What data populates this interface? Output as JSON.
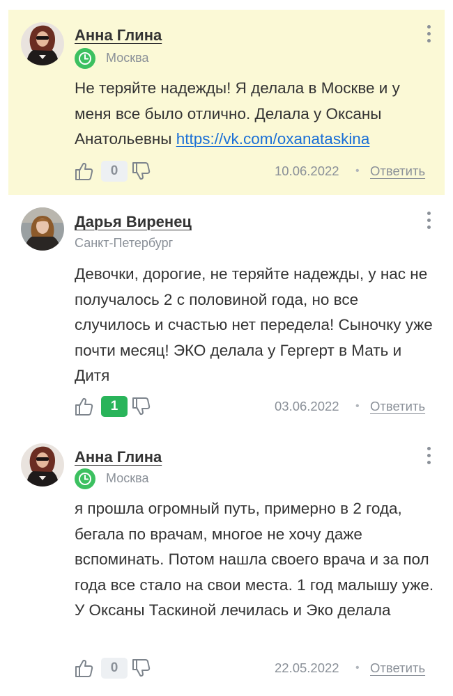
{
  "comments": [
    {
      "author": "Анна Глина",
      "has_verified_badge": true,
      "city": "Москва",
      "text_before_link": "Не теряйте надежды! Я делала в Москве и у меня все было отлично. Делала у Оксаны Анатольевны ",
      "link": "https://vk.com/oxanataskina",
      "votes": "0",
      "date": "10.06.2022",
      "separator": "•",
      "reply_label": "Ответить",
      "highlighted": true,
      "background_color": "#fbf9d6"
    },
    {
      "author": "Дарья Виренец",
      "has_verified_badge": false,
      "city": "Санкт-Петербург",
      "text": "Девочки, дорогие, не теряйте надежды, у нас не получалось 2 с половиной года, но все случилось и счастью нет передела! Сыночку уже почти месяц! ЭКО делала у Гергерт в Мать и Дитя",
      "votes": "1",
      "date": "03.06.2022",
      "separator": "•",
      "reply_label": "Ответить",
      "highlighted": false
    },
    {
      "author": "Анна Глина",
      "has_verified_badge": true,
      "city": "Москва",
      "text": "я прошла огромный путь, примерно в 2 года, бегала по врачам, многое не хочу даже вспоминать. Потом нашла своего врача и за пол года все стало на свои места. 1 год малышу уже. У Оксаны Таскиной лечилась и Эко делала",
      "votes": "0",
      "date": "22.05.2022",
      "separator": "•",
      "reply_label": "Ответить",
      "highlighted": false
    }
  ],
  "icons": {
    "more": "more-vertical-icon",
    "like": "thumb-up-icon",
    "dislike": "thumb-down-icon",
    "badge": "clock-icon"
  },
  "colors": {
    "accent_green": "#29b45a",
    "link_blue": "#1a6fd6",
    "muted_gray": "#8a9098",
    "highlight_bg": "#fbf9d6"
  }
}
